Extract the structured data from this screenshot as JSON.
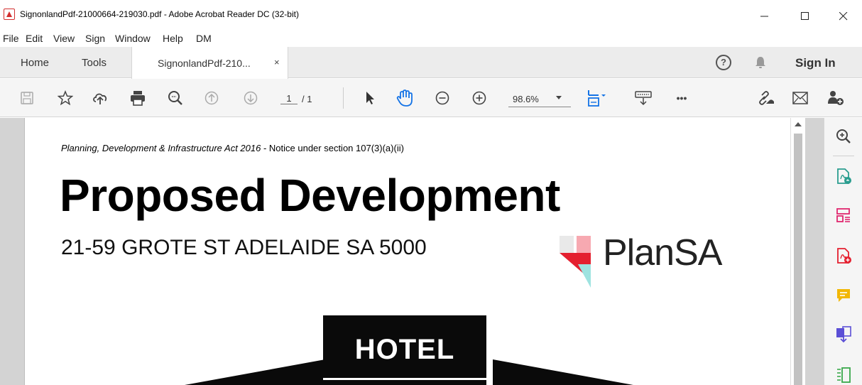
{
  "window": {
    "title": "SignonlandPdf-21000664-219030.pdf - Adobe Acrobat Reader DC (32-bit)"
  },
  "menu": [
    "File",
    "Edit",
    "View",
    "Sign",
    "Window",
    "Help",
    "DM"
  ],
  "tabs": {
    "home": "Home",
    "tools": "Tools",
    "document": "SignonlandPdf-210...",
    "close": "×"
  },
  "header": {
    "help": "?",
    "sign_in": "Sign In"
  },
  "toolbar": {
    "page_current": "1",
    "page_total": "/ 1",
    "zoom": "98.6%",
    "more": "•••"
  },
  "document": {
    "notice_act": "Planning, Development & Infrastructure Act 2016",
    "notice_rest": " - Notice under section 107(3)(a)(ii)",
    "heading": "Proposed Development",
    "address": "21-59 GROTE ST ADELAIDE SA 5000",
    "logo_text": "PlanSA",
    "sign_text": "HOTEL"
  },
  "colors": {
    "acrobat_red": "#d32f2f",
    "accent_blue": "#1473e6",
    "plansa_red": "#e4202f",
    "plansa_pink": "#f7a9b1",
    "plansa_teal": "#9ee3e0"
  },
  "right_pane_icons": [
    "zoom-icon",
    "export-pdf-icon",
    "organize-pages-icon",
    "create-pdf-icon",
    "comment-icon",
    "combine-files-icon",
    "compress-icon"
  ]
}
